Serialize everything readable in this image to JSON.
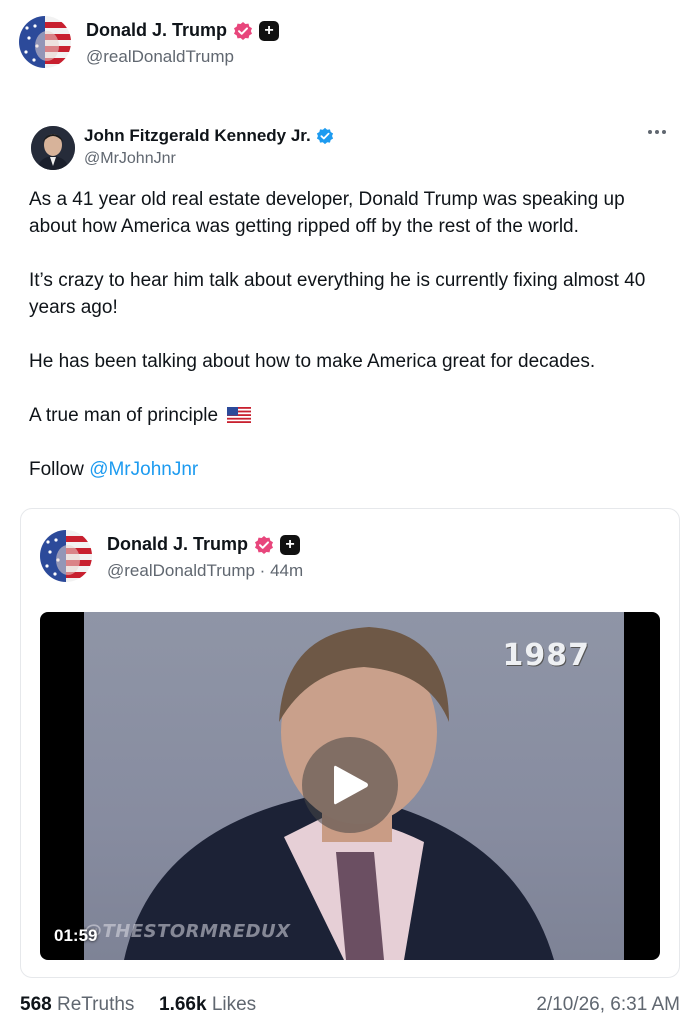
{
  "header": {
    "name": "Donald J. Trump",
    "handle": "@realDonaldTrump"
  },
  "quoted_post": {
    "author_name": "John Fitzgerald Kennedy Jr.",
    "author_handle": "@MrJohnJnr",
    "paragraphs": [
      "As a 41 year old real estate developer, Donald Trump was speaking up about how America was getting ripped off by the rest of the world.",
      "It’s crazy to hear him talk about everything he is currently fixing almost 40 years ago!",
      "He has been talking about how to make America great for decades."
    ],
    "principle_line": "A true man of principle",
    "follow_prefix": "Follow",
    "follow_link": "@MrJohnJnr",
    "embedded": {
      "name": "Donald J. Trump",
      "meta": "@realDonaldTrump · 44m",
      "video": {
        "year_overlay": "1987",
        "duration": "01:59",
        "watermark": "@THESTORMREDUX"
      }
    }
  },
  "footer": {
    "retruths_count": "568",
    "retruths_label": "ReTruths",
    "likes_count": "1.66k",
    "likes_label": "Likes",
    "timestamp": "2/10/26, 6:31 AM"
  },
  "colors": {
    "verified_pink": "#e8467c",
    "verified_blue": "#1d9bf0",
    "link_blue": "#1d9bf0",
    "muted_text": "#606770"
  }
}
